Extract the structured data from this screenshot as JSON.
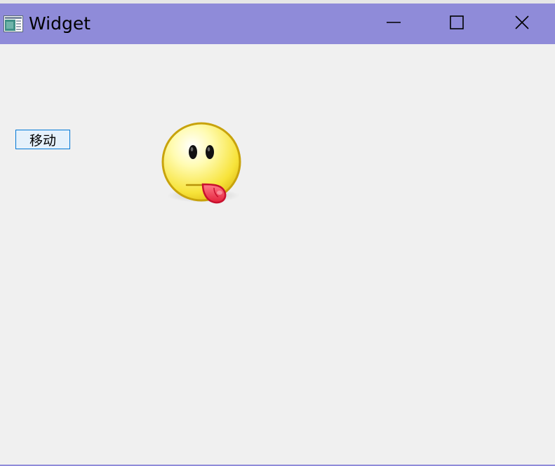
{
  "window": {
    "title": "Widget",
    "title_bar_color": "#8f8bd9",
    "app_icon": "app-window-icon",
    "controls": {
      "minimize_icon": "minimize-icon",
      "maximize_icon": "maximize-icon",
      "close_icon": "close-icon"
    }
  },
  "content": {
    "move_button_label": "移动",
    "emoji_image": "tongue-out-smiley-icon"
  }
}
